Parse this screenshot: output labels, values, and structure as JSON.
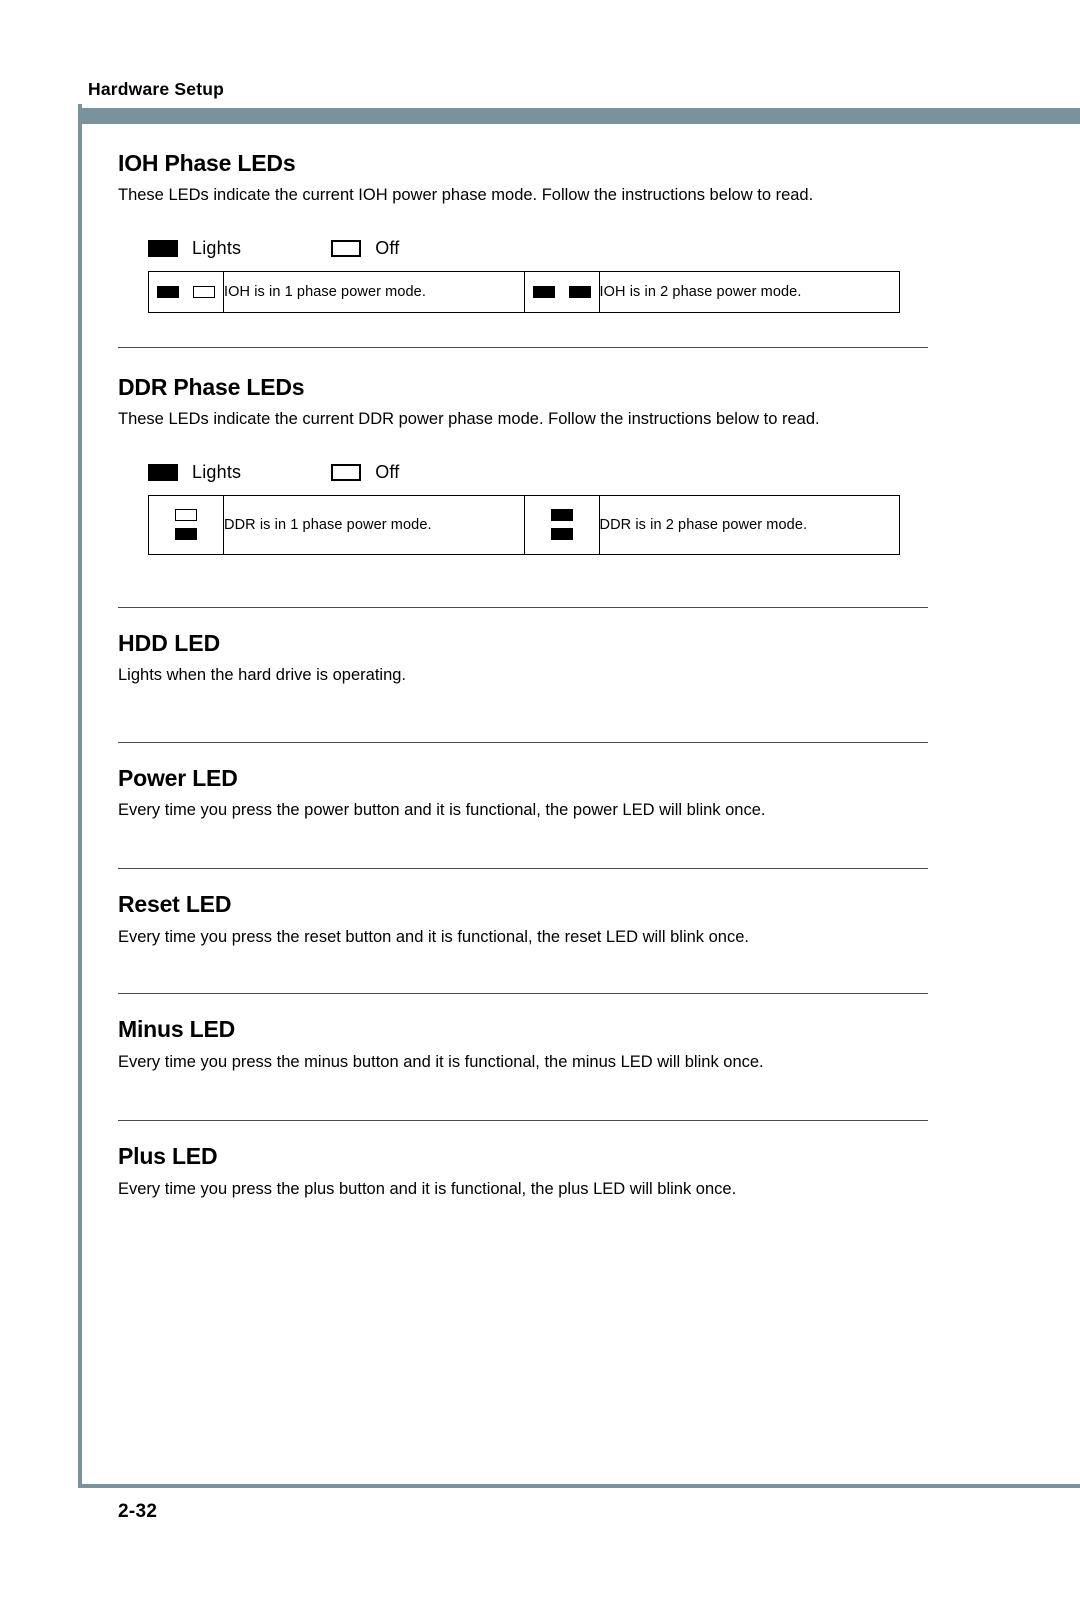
{
  "header": {
    "running_title": "Hardware Setup"
  },
  "colors": {
    "accent_bar": "#7a929b",
    "rule": "#4a4a4a",
    "text": "#000000",
    "page_background": "#ffffff"
  },
  "legend": {
    "lights_label": "Lights",
    "off_label": "Off",
    "lights_icon": "filled-square-icon",
    "off_icon": "outlined-square-icon"
  },
  "sections": [
    {
      "id": "ioh-phase-leds",
      "title": "IOH Phase LEDs",
      "body": "These LEDs indicate the current IOH power phase mode. Follow the instructions below to read.",
      "has_rule_above": false,
      "has_legend": true,
      "table": {
        "orientation": "horizontal",
        "cells": [
          {
            "leds": [
              "on",
              "off"
            ],
            "text": "IOH is in 1 phase power mode."
          },
          {
            "leds": [
              "on",
              "on"
            ],
            "text": "IOH is in 2 phase power mode."
          }
        ]
      }
    },
    {
      "id": "ddr-phase-leds",
      "title": "DDR Phase LEDs",
      "body": "These LEDs indicate the current DDR power phase mode. Follow the instructions below to read.",
      "has_rule_above": true,
      "has_legend": true,
      "table": {
        "orientation": "vertical",
        "cells": [
          {
            "leds": [
              "off",
              "on"
            ],
            "text": "DDR is in 1 phase power mode."
          },
          {
            "leds": [
              "on",
              "on"
            ],
            "text": "DDR is in 2 phase power mode."
          }
        ]
      }
    },
    {
      "id": "hdd-led",
      "title": "HDD LED",
      "body": "Lights when the hard drive is operating.",
      "has_rule_above": true,
      "has_legend": false,
      "table": null
    },
    {
      "id": "power-led",
      "title": "Power LED",
      "body": "Every time you press the power button and it is functional, the power LED will blink once.",
      "has_rule_above": true,
      "has_legend": false,
      "table": null
    },
    {
      "id": "reset-led",
      "title": "Reset LED",
      "body": "Every time you press the reset button and it is functional, the reset LED will blink once.",
      "has_rule_above": true,
      "has_legend": false,
      "table": null
    },
    {
      "id": "minus-led",
      "title": "Minus LED",
      "body": "Every time you press the minus button and it is functional, the minus LED will blink once.",
      "has_rule_above": true,
      "has_legend": false,
      "table": null
    },
    {
      "id": "plus-led",
      "title": "Plus LED",
      "body": "Every time you press the plus button and it is functional, the plus LED will blink once.",
      "has_rule_above": true,
      "has_legend": false,
      "table": null
    }
  ],
  "footer": {
    "page_number": "2-32"
  }
}
